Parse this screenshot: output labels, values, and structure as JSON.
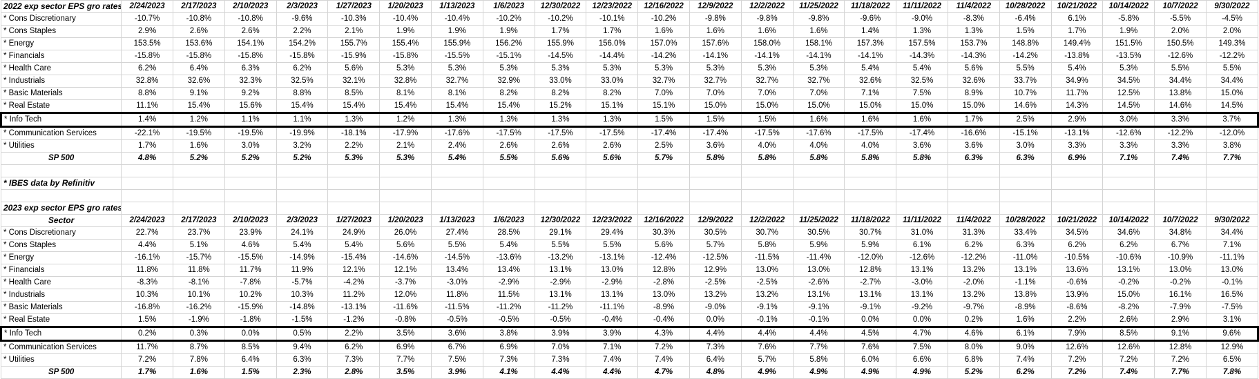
{
  "spreadsheet": {
    "tables": [
      {
        "title": "2022 exp sector EPS gro rates",
        "sector_header": "",
        "dates": [
          "2/24/2023",
          "2/17/2023",
          "2/10/2023",
          "2/3/2023",
          "1/27/2023",
          "1/20/2023",
          "1/13/2023",
          "1/6/2023",
          "12/30/2022",
          "12/23/2022",
          "12/16/2022",
          "12/9/2022",
          "12/2/2022",
          "11/25/2022",
          "11/18/2022",
          "11/11/2022",
          "11/4/2022",
          "10/28/2022",
          "10/21/2022",
          "10/14/2022",
          "10/7/2022",
          "9/30/2022"
        ],
        "rows": [
          {
            "label": "* Cons Discretionary",
            "highlight": false,
            "total": false,
            "values": [
              "-10.7%",
              "-10.8%",
              "-10.8%",
              "-9.6%",
              "-10.3%",
              "-10.4%",
              "-10.4%",
              "-10.2%",
              "-10.2%",
              "-10.1%",
              "-10.2%",
              "-9.8%",
              "-9.8%",
              "-9.8%",
              "-9.6%",
              "-9.0%",
              "-8.3%",
              "-6.4%",
              "6.1%",
              "-5.8%",
              "-5.5%",
              "-4.5%"
            ]
          },
          {
            "label": "* Cons Staples",
            "highlight": false,
            "total": false,
            "values": [
              "2.9%",
              "2.6%",
              "2.6%",
              "2.2%",
              "2.1%",
              "1.9%",
              "1.9%",
              "1.9%",
              "1.7%",
              "1.7%",
              "1.6%",
              "1.6%",
              "1.6%",
              "1.6%",
              "1.4%",
              "1.3%",
              "1.3%",
              "1.5%",
              "1.7%",
              "1.9%",
              "2.0%",
              "2.0%"
            ]
          },
          {
            "label": "* Energy",
            "highlight": false,
            "total": false,
            "values": [
              "153.5%",
              "153.6%",
              "154.1%",
              "154.2%",
              "155.7%",
              "155.4%",
              "155.9%",
              "156.2%",
              "155.9%",
              "156.0%",
              "157.0%",
              "157.6%",
              "158.0%",
              "158.1%",
              "157.3%",
              "157.5%",
              "153.7%",
              "148.8%",
              "149.4%",
              "151.5%",
              "150.5%",
              "149.3%"
            ]
          },
          {
            "label": "* Financials",
            "highlight": false,
            "total": false,
            "values": [
              "-15.8%",
              "-15.8%",
              "-15.8%",
              "-15.8%",
              "-15.9%",
              "-15.8%",
              "-15.5%",
              "-15.1%",
              "-14.5%",
              "-14.4%",
              "-14.2%",
              "-14.1%",
              "-14.1%",
              "-14.1%",
              "-14.1%",
              "-14.3%",
              "-14.3%",
              "-14.2%",
              "-13.8%",
              "-13.5%",
              "-12.6%",
              "-12.2%"
            ]
          },
          {
            "label": "* Health Care",
            "highlight": false,
            "total": false,
            "values": [
              "6.2%",
              "6.4%",
              "6.3%",
              "6.2%",
              "5.6%",
              "5.3%",
              "5.3%",
              "5.3%",
              "5.3%",
              "5.3%",
              "5.3%",
              "5.3%",
              "5.3%",
              "5.3%",
              "5.4%",
              "5.4%",
              "5.6%",
              "5.5%",
              "5.4%",
              "5.3%",
              "5.5%",
              "5.5%"
            ]
          },
          {
            "label": "* Industrials",
            "highlight": false,
            "total": false,
            "values": [
              "32.8%",
              "32.6%",
              "32.3%",
              "32.5%",
              "32.1%",
              "32.8%",
              "32.7%",
              "32.9%",
              "33.0%",
              "33.0%",
              "32.7%",
              "32.7%",
              "32.7%",
              "32.7%",
              "32.6%",
              "32.5%",
              "32.6%",
              "33.7%",
              "34.9%",
              "34.5%",
              "34.4%",
              "34.4%"
            ]
          },
          {
            "label": "* Basic Materials",
            "highlight": false,
            "total": false,
            "values": [
              "8.8%",
              "9.1%",
              "9.2%",
              "8.8%",
              "8.5%",
              "8.1%",
              "8.1%",
              "8.2%",
              "8.2%",
              "8.2%",
              "7.0%",
              "7.0%",
              "7.0%",
              "7.0%",
              "7.1%",
              "7.5%",
              "8.9%",
              "10.7%",
              "11.7%",
              "12.5%",
              "13.8%",
              "15.0%"
            ]
          },
          {
            "label": "* Real Estate",
            "highlight": false,
            "total": false,
            "values": [
              "11.1%",
              "15.4%",
              "15.6%",
              "15.4%",
              "15.4%",
              "15.4%",
              "15.4%",
              "15.4%",
              "15.2%",
              "15.1%",
              "15.1%",
              "15.0%",
              "15.0%",
              "15.0%",
              "15.0%",
              "15.0%",
              "15.0%",
              "14.6%",
              "14.3%",
              "14.5%",
              "14.6%",
              "14.5%"
            ]
          },
          {
            "label": "* Info Tech",
            "highlight": true,
            "total": false,
            "values": [
              "1.4%",
              "1.2%",
              "1.1%",
              "1.1%",
              "1.3%",
              "1.2%",
              "1.3%",
              "1.3%",
              "1.3%",
              "1.3%",
              "1.5%",
              "1.5%",
              "1.5%",
              "1.6%",
              "1.6%",
              "1.6%",
              "1.7%",
              "2.5%",
              "2.9%",
              "3.0%",
              "3.3%",
              "3.7%"
            ]
          },
          {
            "label": "* Communication Services",
            "highlight": false,
            "total": false,
            "values": [
              "-22.1%",
              "-19.5%",
              "-19.5%",
              "-19.9%",
              "-18.1%",
              "-17.9%",
              "-17.6%",
              "-17.5%",
              "-17.5%",
              "-17.5%",
              "-17.4%",
              "-17.4%",
              "-17.5%",
              "-17.6%",
              "-17.5%",
              "-17.4%",
              "-16.6%",
              "-15.1%",
              "-13.1%",
              "-12.6%",
              "-12.2%",
              "-12.0%"
            ]
          },
          {
            "label": "* Utilities",
            "highlight": false,
            "total": false,
            "values": [
              "1.7%",
              "1.6%",
              "3.0%",
              "3.2%",
              "2.2%",
              "2.1%",
              "2.4%",
              "2.6%",
              "2.6%",
              "2.6%",
              "2.5%",
              "3.6%",
              "4.0%",
              "4.0%",
              "4.0%",
              "3.6%",
              "3.6%",
              "3.0%",
              "3.3%",
              "3.3%",
              "3.3%",
              "3.8%"
            ]
          },
          {
            "label": "SP 500",
            "highlight": false,
            "total": true,
            "values": [
              "4.8%",
              "5.2%",
              "5.2%",
              "5.2%",
              "5.3%",
              "5.3%",
              "5.4%",
              "5.5%",
              "5.6%",
              "5.6%",
              "5.7%",
              "5.8%",
              "5.8%",
              "5.8%",
              "5.8%",
              "5.8%",
              "6.3%",
              "6.3%",
              "6.9%",
              "7.1%",
              "7.4%",
              "7.7%"
            ]
          }
        ]
      },
      {
        "title": "2023 exp sector EPS gro rates",
        "sector_header": "Sector",
        "dates": [
          "2/24/2023",
          "2/17/2023",
          "2/10/2023",
          "2/3/2023",
          "1/27/2023",
          "1/20/2023",
          "1/13/2023",
          "1/6/2023",
          "12/30/2022",
          "12/23/2022",
          "12/16/2022",
          "12/9/2022",
          "12/2/2022",
          "11/25/2022",
          "11/18/2022",
          "11/11/2022",
          "11/4/2022",
          "10/28/2022",
          "10/21/2022",
          "10/14/2022",
          "10/7/2022",
          "9/30/2022"
        ],
        "rows": [
          {
            "label": "* Cons Discretionary",
            "highlight": false,
            "total": false,
            "values": [
              "22.7%",
              "23.7%",
              "23.9%",
              "24.1%",
              "24.9%",
              "26.0%",
              "27.4%",
              "28.5%",
              "29.1%",
              "29.4%",
              "30.3%",
              "30.5%",
              "30.7%",
              "30.5%",
              "30.7%",
              "31.0%",
              "31.3%",
              "33.4%",
              "34.5%",
              "34.6%",
              "34.8%",
              "34.4%"
            ]
          },
          {
            "label": "* Cons Staples",
            "highlight": false,
            "total": false,
            "values": [
              "4.4%",
              "5.1%",
              "4.6%",
              "5.4%",
              "5.4%",
              "5.6%",
              "5.5%",
              "5.4%",
              "5.5%",
              "5.5%",
              "5.6%",
              "5.7%",
              "5.8%",
              "5.9%",
              "5.9%",
              "6.1%",
              "6.2%",
              "6.3%",
              "6.2%",
              "6.2%",
              "6.7%",
              "7.1%"
            ]
          },
          {
            "label": "* Energy",
            "highlight": false,
            "total": false,
            "values": [
              "-16.1%",
              "-15.7%",
              "-15.5%",
              "-14.9%",
              "-15.4%",
              "-14.6%",
              "-14.5%",
              "-13.6%",
              "-13.2%",
              "-13.1%",
              "-12.4%",
              "-12.5%",
              "-11.5%",
              "-11.4%",
              "-12.0%",
              "-12.6%",
              "-12.2%",
              "-11.0%",
              "-10.5%",
              "-10.6%",
              "-10.9%",
              "-11.1%"
            ]
          },
          {
            "label": "* Financials",
            "highlight": false,
            "total": false,
            "values": [
              "11.8%",
              "11.8%",
              "11.7%",
              "11.9%",
              "12.1%",
              "12.1%",
              "13.4%",
              "13.4%",
              "13.1%",
              "13.0%",
              "12.8%",
              "12.9%",
              "13.0%",
              "13.0%",
              "12.8%",
              "13.1%",
              "13.2%",
              "13.1%",
              "13.6%",
              "13.1%",
              "13.0%",
              "13.0%"
            ]
          },
          {
            "label": "* Health Care",
            "highlight": false,
            "total": false,
            "values": [
              "-8.3%",
              "-8.1%",
              "-7.8%",
              "-5.7%",
              "-4.2%",
              "-3.7%",
              "-3.0%",
              "-2.9%",
              "-2.9%",
              "-2.9%",
              "-2.8%",
              "-2.5%",
              "-2.5%",
              "-2.6%",
              "-2.7%",
              "-3.0%",
              "-2.0%",
              "-1.1%",
              "-0.6%",
              "-0.2%",
              "-0.2%",
              "-0.1%"
            ]
          },
          {
            "label": "* Industrials",
            "highlight": false,
            "total": false,
            "values": [
              "10.3%",
              "10.1%",
              "10.2%",
              "10.3%",
              "11.2%",
              "12.0%",
              "11.8%",
              "11.5%",
              "13.1%",
              "13.1%",
              "13.0%",
              "13.2%",
              "13.2%",
              "13.1%",
              "13.1%",
              "13.1%",
              "13.2%",
              "13.8%",
              "13.9%",
              "15.0%",
              "16.1%",
              "16.5%"
            ]
          },
          {
            "label": "* Basic Materials",
            "highlight": false,
            "total": false,
            "values": [
              "-16.8%",
              "-16.2%",
              "-15.9%",
              "-14.8%",
              "-13.1%",
              "-11.6%",
              "-11.5%",
              "-11.2%",
              "-11.2%",
              "-11.1%",
              "-8.9%",
              "-9.0%",
              "-9.1%",
              "-9.1%",
              "-9.1%",
              "-9.2%",
              "-9.7%",
              "-8.9%",
              "-8.6%",
              "-8.2%",
              "-7.9%",
              "-7.5%"
            ]
          },
          {
            "label": "* Real Estate",
            "highlight": false,
            "total": false,
            "values": [
              "1.5%",
              "-1.9%",
              "-1.8%",
              "-1.5%",
              "-1.2%",
              "-0.8%",
              "-0.5%",
              "-0.5%",
              "-0.5%",
              "-0.4%",
              "-0.4%",
              "0.0%",
              "-0.1%",
              "-0.1%",
              "0.0%",
              "0.0%",
              "0.2%",
              "1.6%",
              "2.2%",
              "2.6%",
              "2.9%",
              "3.1%"
            ]
          },
          {
            "label": "* Info Tech",
            "highlight": true,
            "total": false,
            "values": [
              "0.2%",
              "0.3%",
              "0.0%",
              "0.5%",
              "2.2%",
              "3.5%",
              "3.6%",
              "3.8%",
              "3.9%",
              "3.9%",
              "4.3%",
              "4.4%",
              "4.4%",
              "4.4%",
              "4.5%",
              "4.7%",
              "4.6%",
              "6.1%",
              "7.9%",
              "8.5%",
              "9.1%",
              "9.6%"
            ]
          },
          {
            "label": "* Communication Services",
            "highlight": false,
            "total": false,
            "values": [
              "11.7%",
              "8.7%",
              "8.5%",
              "9.4%",
              "6.2%",
              "6.9%",
              "6.7%",
              "6.9%",
              "7.0%",
              "7.1%",
              "7.2%",
              "7.3%",
              "7.6%",
              "7.7%",
              "7.6%",
              "7.5%",
              "8.0%",
              "9.0%",
              "12.6%",
              "12.6%",
              "12.8%",
              "12.9%"
            ]
          },
          {
            "label": "* Utilities",
            "highlight": false,
            "total": false,
            "values": [
              "7.2%",
              "7.8%",
              "6.4%",
              "6.3%",
              "7.3%",
              "7.7%",
              "7.5%",
              "7.3%",
              "7.3%",
              "7.4%",
              "7.4%",
              "6.4%",
              "5.7%",
              "5.8%",
              "6.0%",
              "6.6%",
              "6.8%",
              "7.4%",
              "7.2%",
              "7.2%",
              "7.2%",
              "6.5%"
            ]
          },
          {
            "label": "SP 500",
            "highlight": false,
            "total": true,
            "values": [
              "1.7%",
              "1.6%",
              "1.5%",
              "2.3%",
              "2.8%",
              "3.5%",
              "3.9%",
              "4.1%",
              "4.4%",
              "4.4%",
              "4.7%",
              "4.8%",
              "4.9%",
              "4.9%",
              "4.9%",
              "4.9%",
              "5.2%",
              "6.2%",
              "7.2%",
              "7.4%",
              "7.7%",
              "7.8%"
            ]
          }
        ]
      }
    ],
    "footnote": "* IBES data by Refinitiv"
  }
}
